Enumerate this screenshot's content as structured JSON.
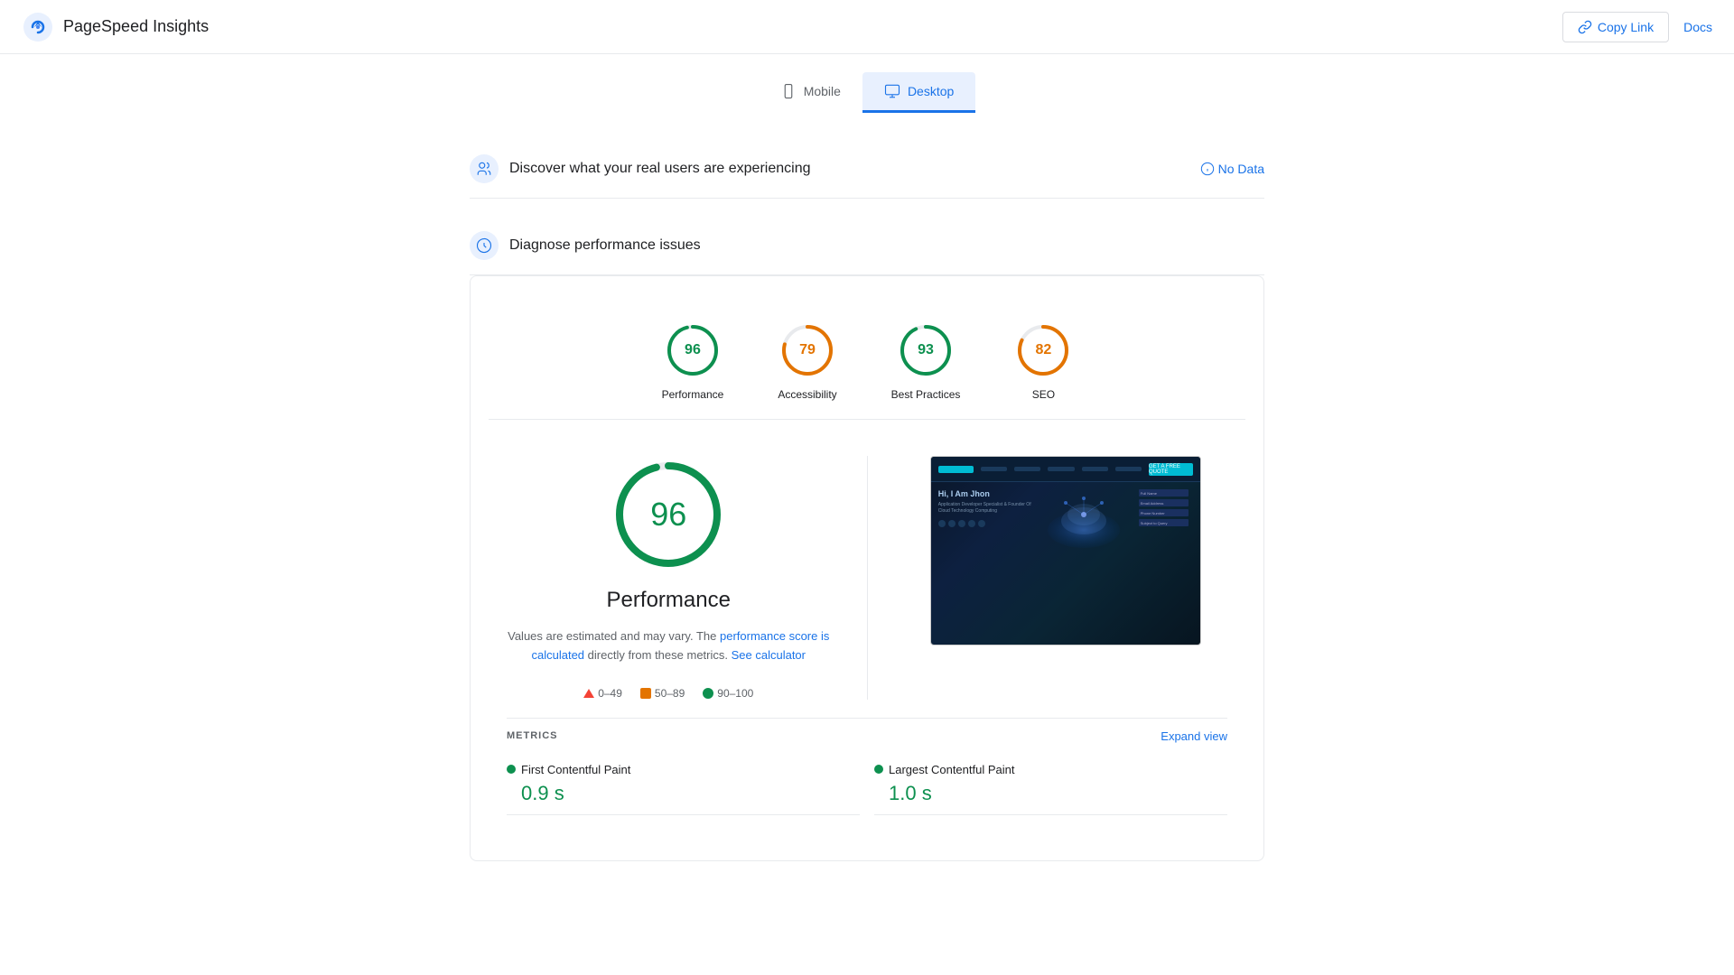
{
  "header": {
    "title": "PageSpeed Insights",
    "copy_link_label": "Copy Link",
    "docs_label": "Docs"
  },
  "tabs": [
    {
      "id": "mobile",
      "label": "Mobile",
      "active": false
    },
    {
      "id": "desktop",
      "label": "Desktop",
      "active": true
    }
  ],
  "sections": {
    "real_users": {
      "title": "Discover what your real users are experiencing",
      "no_data_label": "No Data"
    },
    "diagnose": {
      "title": "Diagnose performance issues"
    }
  },
  "scores": [
    {
      "id": "performance",
      "label": "Performance",
      "value": 96,
      "color": "green",
      "stroke": "#0d904f",
      "pct": 96
    },
    {
      "id": "accessibility",
      "label": "Accessibility",
      "value": 79,
      "color": "orange",
      "stroke": "#e37400",
      "pct": 79
    },
    {
      "id": "best_practices",
      "label": "Best Practices",
      "value": 93,
      "color": "green",
      "stroke": "#0d904f",
      "pct": 93
    },
    {
      "id": "seo",
      "label": "SEO",
      "value": 82,
      "color": "orange",
      "stroke": "#e37400",
      "pct": 82
    }
  ],
  "performance_detail": {
    "big_score": 96,
    "title": "Performance",
    "desc_before": "Values are estimated and may vary. The",
    "desc_link": "performance score is calculated",
    "desc_middle": "directly from these metrics.",
    "desc_link2": "See calculator",
    "legend": [
      {
        "type": "triangle",
        "range": "0–49",
        "color": "#f44336"
      },
      {
        "type": "square",
        "range": "50–89",
        "color": "#e37400"
      },
      {
        "type": "circle",
        "range": "90–100",
        "color": "#0d904f"
      }
    ]
  },
  "metrics": {
    "title": "METRICS",
    "expand_label": "Expand view",
    "items": [
      {
        "label": "First Contentful Paint",
        "value": "0.9 s",
        "color": "#0d904f"
      },
      {
        "label": "Largest Contentful Paint",
        "value": "1.0 s",
        "color": "#0d904f"
      }
    ]
  },
  "colors": {
    "green": "#0d904f",
    "orange": "#e37400",
    "red": "#f44336",
    "blue": "#1a73e8"
  }
}
